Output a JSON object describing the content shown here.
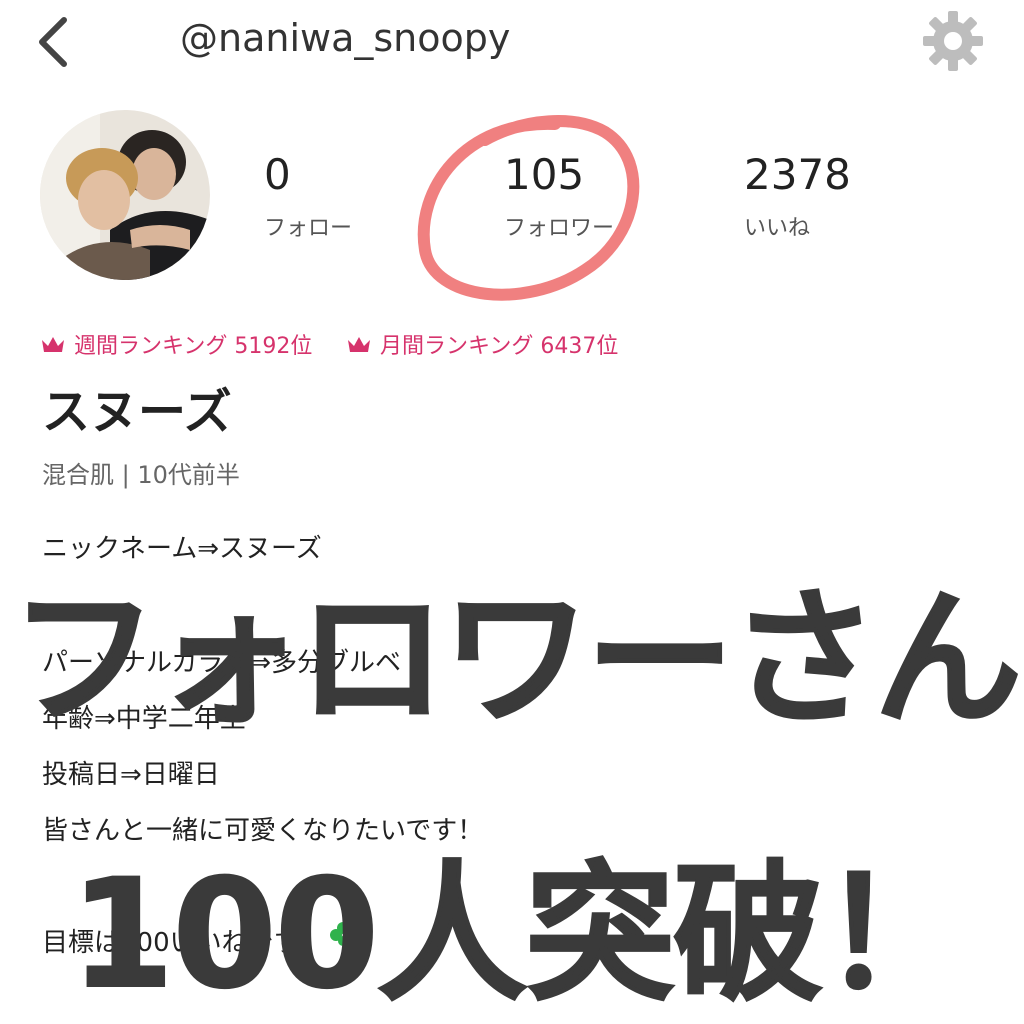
{
  "header": {
    "handle": "@naniwa_snoopy"
  },
  "stats": {
    "following": {
      "value": "0",
      "label": "フォロー"
    },
    "followers": {
      "value": "105",
      "label": "フォロワー"
    },
    "likes": {
      "value": "2378",
      "label": "いいね"
    }
  },
  "rankings": {
    "weekly": "週間ランキング 5192位",
    "monthly": "月間ランキング 6437位"
  },
  "profile": {
    "name": "スヌーズ",
    "meta": "混合肌 | 10代前半"
  },
  "bio": {
    "line1": "ニックネーム⇒スヌーズ",
    "line2": "パーソナルカラー⇒多分ブルベ",
    "line3": "年齢⇒中学二年生",
    "line4": "投稿日⇒日曜日",
    "line5": "皆さんと一緒に可愛くなりたいです！",
    "line6": "目標は100いいねです"
  },
  "overlay": {
    "line1": "フォロワーさん",
    "line2": "100人突破！"
  },
  "colors": {
    "accent": "#d6336c",
    "circle": "#f08080",
    "gear": "#bdbdbd"
  },
  "icons": [
    "back-arrow-icon",
    "gear-icon",
    "crown-icon",
    "clover-icon"
  ]
}
